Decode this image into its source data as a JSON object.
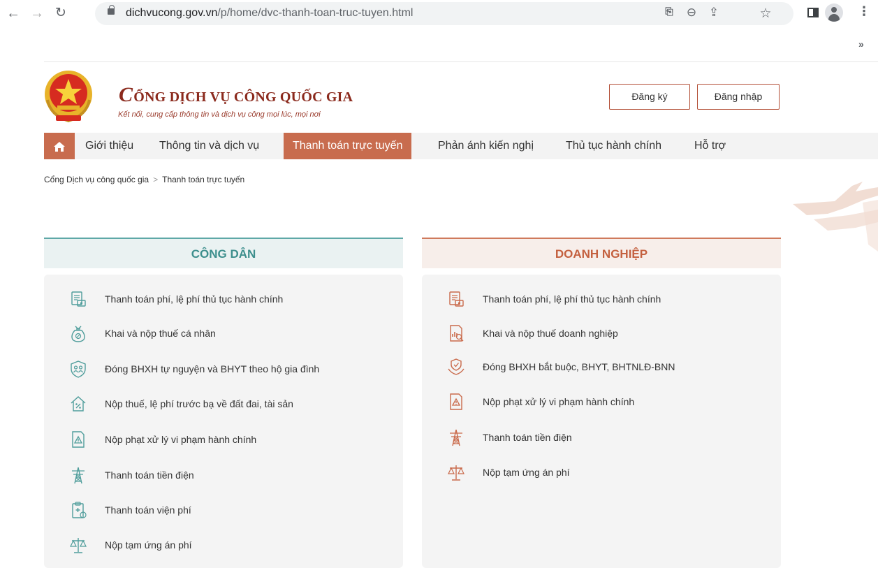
{
  "browser": {
    "url_host": "dichvucong.gov.vn",
    "url_path": "/p/home/dvc-thanh-toan-truc-tuyen.html"
  },
  "header": {
    "title_initial": "C",
    "title_rest": "ỔNG DỊCH VỤ CÔNG QUỐC GIA",
    "subtitle": "Kết nối, cung cấp thông tin và dịch vụ công mọi lúc, mọi nơi",
    "register_label": "Đăng ký",
    "login_label": "Đăng nhập"
  },
  "nav": {
    "items": [
      {
        "label": "Giới thiệu"
      },
      {
        "label": "Thông tin và dịch vụ"
      },
      {
        "label": "Thanh toán trực tuyến"
      },
      {
        "label": "Phản ánh kiến nghị"
      },
      {
        "label": "Thủ tục hành chính"
      },
      {
        "label": "Hỗ trợ"
      }
    ]
  },
  "breadcrumb": {
    "home": "Cổng Dịch vụ công quốc gia",
    "separator": ">",
    "current": "Thanh toán trực tuyến"
  },
  "citizen": {
    "title": "CÔNG DÂN",
    "items": [
      {
        "label": "Thanh toán phí, lệ phí thủ tục hành chính",
        "icon": "fee-document-icon"
      },
      {
        "label": "Khai và nộp thuế cá nhân",
        "icon": "money-bag-icon"
      },
      {
        "label": "Đóng BHXH tự nguyện và BHYT theo hộ gia đình",
        "icon": "family-shield-icon"
      },
      {
        "label": "Nộp thuế, lệ phí trước bạ về đất đai, tài sản",
        "icon": "house-percent-icon"
      },
      {
        "label": "Nộp phạt xử lý vi phạm hành chính",
        "icon": "warning-document-icon"
      },
      {
        "label": "Thanh toán tiền điện",
        "icon": "power-tower-icon"
      },
      {
        "label": "Thanh toán viện phí",
        "icon": "medical-clipboard-icon"
      },
      {
        "label": "Nộp tạm ứng án phí",
        "icon": "scales-icon"
      }
    ]
  },
  "business": {
    "title": "DOANH NGHIỆP",
    "items": [
      {
        "label": "Thanh toán phí, lệ phí thủ tục hành chính",
        "icon": "fee-document-icon"
      },
      {
        "label": "Khai và nộp thuế doanh nghiệp",
        "icon": "tax-chart-icon"
      },
      {
        "label": "Đóng BHXH bắt buộc, BHYT, BHTNLĐ-BNN",
        "icon": "hand-shield-icon"
      },
      {
        "label": "Nộp phạt xử lý vi phạm hành chính",
        "icon": "warning-document-icon"
      },
      {
        "label": "Thanh toán tiền điện",
        "icon": "power-tower-icon"
      },
      {
        "label": "Nộp tạm ứng án phí",
        "icon": "scales-icon"
      }
    ]
  },
  "colors": {
    "brand_red": "#8b2a1d",
    "accent_orange": "#c86c4e",
    "citizen_teal": "#5ea8a7",
    "business_orange": "#cf7a5c",
    "citizen_icon": "#4f9d9b",
    "business_icon": "#c96a4b"
  }
}
